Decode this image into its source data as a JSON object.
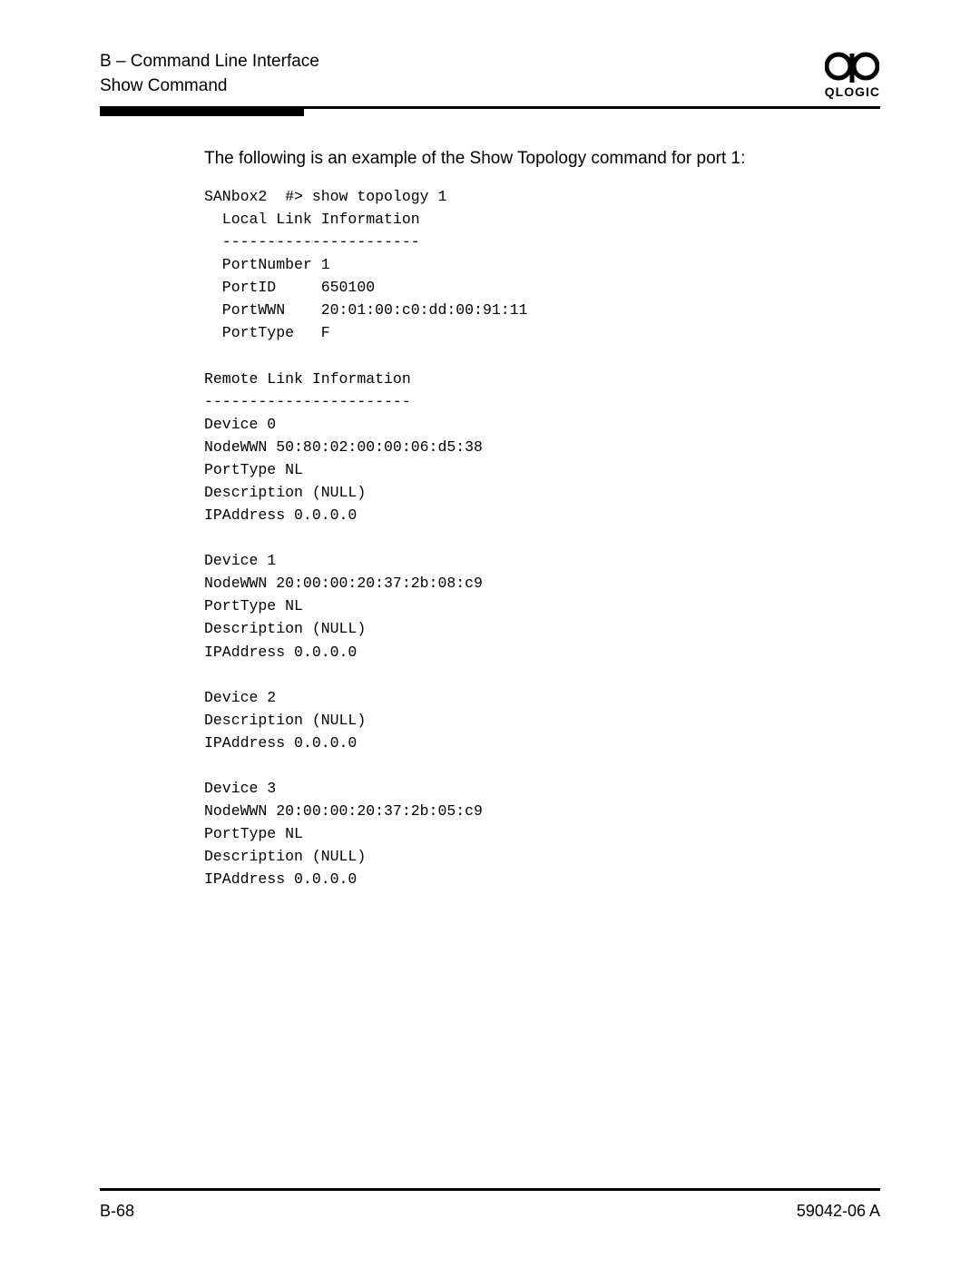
{
  "header": {
    "line1": "B – Command Line Interface",
    "line2": "Show Command",
    "logo_text": "QLOGIC"
  },
  "intro": "The following is an example of the Show Topology command for port 1:",
  "code": "SANbox2  #> show topology 1\n  Local Link Information\n  ----------------------\n  PortNumber 1\n  PortID     650100\n  PortWWN    20:01:00:c0:dd:00:91:11\n  PortType   F\n\nRemote Link Information\n-----------------------\nDevice 0 \nNodeWWN 50:80:02:00:00:06:d5:38\nPortType NL\nDescription (NULL)\nIPAddress 0.0.0.0\n\nDevice 1 \nNodeWWN 20:00:00:20:37:2b:08:c9\nPortType NL\nDescription (NULL)\nIPAddress 0.0.0.0\n\nDevice 2 \nDescription (NULL)\nIPAddress 0.0.0.0\n\nDevice 3 \nNodeWWN 20:00:00:20:37:2b:05:c9\nPortType NL\nDescription (NULL)\nIPAddress 0.0.0.0",
  "footer": {
    "page_number": "B-68",
    "doc_id": "59042-06  A"
  }
}
